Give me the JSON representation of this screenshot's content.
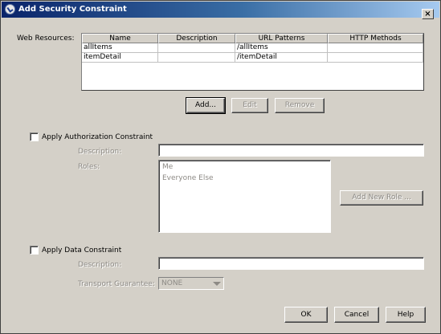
{
  "window": {
    "title": "Add Security Constraint",
    "close_glyph": "×"
  },
  "web_resources": {
    "label": "Web Resources:",
    "columns": [
      "Name",
      "Description",
      "URL Patterns",
      "HTTP Methods"
    ],
    "rows": [
      {
        "name": "allItems",
        "description": "",
        "url_patterns": "/allItems",
        "http_methods": ""
      },
      {
        "name": "itemDetail",
        "description": "",
        "url_patterns": "/itemDetail",
        "http_methods": ""
      }
    ],
    "buttons": {
      "add": "Add...",
      "edit": "Edit",
      "remove": "Remove"
    }
  },
  "authorization": {
    "checkbox_label": "Apply Authorization Constraint",
    "checked": false,
    "description_label": "Description:",
    "description_value": "",
    "roles_label": "Roles:",
    "roles": [
      "Me",
      "Everyone Else"
    ],
    "add_role_button": "Add New Role ..."
  },
  "data_constraint": {
    "checkbox_label": "Apply Data Constraint",
    "checked": false,
    "description_label": "Description:",
    "description_value": "",
    "transport_label": "Transport Guarantee:",
    "transport_value": "NONE"
  },
  "footer": {
    "ok": "OK",
    "cancel": "Cancel",
    "help": "Help"
  },
  "colors": {
    "disabled_text": "#8d8a85",
    "title_gradient_start": "#0a246a",
    "title_gradient_end": "#a6caf0"
  }
}
